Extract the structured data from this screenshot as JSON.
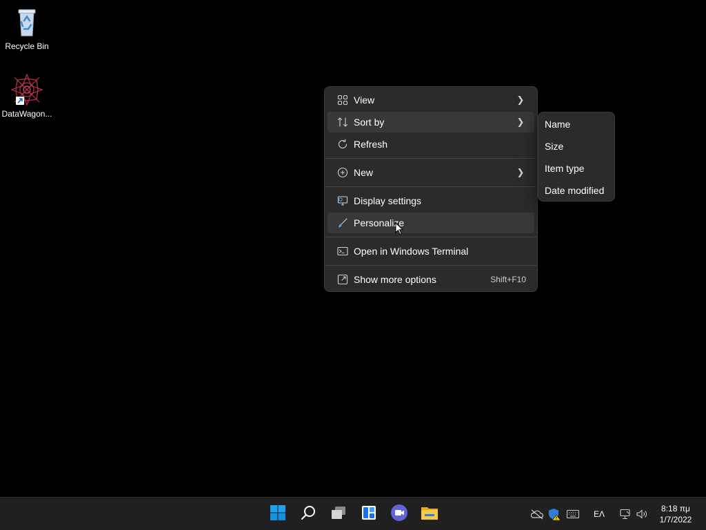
{
  "desktop": {
    "icons": [
      {
        "label": "Recycle Bin",
        "icon": "recycle-bin-icon"
      },
      {
        "label": "DataWagon...",
        "icon": "datawagon-app-icon"
      }
    ]
  },
  "context_menu": {
    "items": [
      {
        "label": "View",
        "icon": "grid-view-icon",
        "has_submenu": true
      },
      {
        "label": "Sort by",
        "icon": "sort-icon",
        "has_submenu": true
      },
      {
        "label": "Refresh",
        "icon": "refresh-icon"
      },
      {
        "label": "New",
        "icon": "new-plus-icon",
        "has_submenu": true
      },
      {
        "label": "Display settings",
        "icon": "display-settings-icon"
      },
      {
        "label": "Personalize",
        "icon": "personalize-brush-icon"
      },
      {
        "label": "Open in Windows Terminal",
        "icon": "terminal-icon"
      },
      {
        "label": "Show more options",
        "icon": "more-options-icon",
        "shortcut": "Shift+F10"
      }
    ],
    "hovered": "Personalize",
    "expanded": "Sort by"
  },
  "sort_submenu": {
    "items": [
      "Name",
      "Size",
      "Item type",
      "Date modified"
    ]
  },
  "taskbar": {
    "apps": [
      "start-icon",
      "search-icon",
      "task-view-icon",
      "widgets-icon",
      "teams-chat-icon",
      "file-explorer-icon"
    ],
    "tray": {
      "icons": [
        "onedrive-offline-icon",
        "windows-security-warning-icon",
        "keyboard-icon",
        "network-icon",
        "volume-icon"
      ],
      "language": "ΕΛ"
    },
    "clock": {
      "time": "8:18 πμ",
      "date": "1/7/2022"
    }
  },
  "colors": {
    "menu_bg": "#2b2b2b",
    "hover_bg": "#383838",
    "taskbar_bg": "#202020",
    "accent": "#0078d4"
  }
}
